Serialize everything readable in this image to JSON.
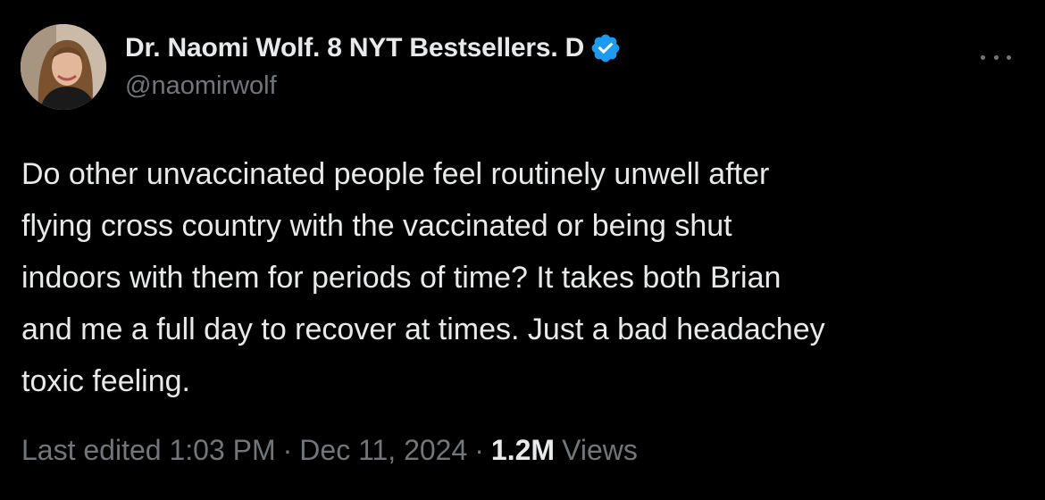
{
  "tweet": {
    "display_name": "Dr. Naomi Wolf. 8 NYT Bestsellers. D",
    "handle": "@naomirwolf",
    "body_lines": [
      "Do other unvaccinated people feel routinely unwell after",
      "flying cross country with the vaccinated or being shut",
      "indoors with them for periods of time? It takes both Brian",
      "and me a full day to recover at times. Just a bad headachey",
      "toxic feeling."
    ],
    "edited_label": "Last edited 1:03 PM",
    "separator": "·",
    "date": "Dec 11, 2024",
    "views_count": "1.2M",
    "views_label": "Views"
  },
  "icons": {
    "verified": "verified-badge-icon",
    "more": "more-options-icon"
  },
  "colors": {
    "background": "#000000",
    "primary_text": "#e7e9ea",
    "secondary_text": "#71767b",
    "verified_blue": "#1d9bf0"
  }
}
